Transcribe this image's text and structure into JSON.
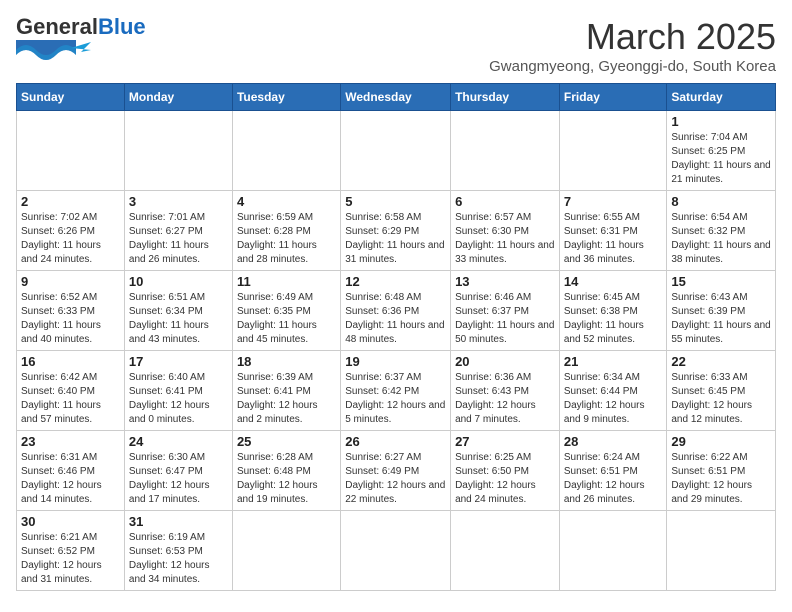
{
  "header": {
    "logo_general": "General",
    "logo_blue": "Blue",
    "month_title": "March 2025",
    "location": "Gwangmyeong, Gyeonggi-do, South Korea"
  },
  "weekdays": [
    "Sunday",
    "Monday",
    "Tuesday",
    "Wednesday",
    "Thursday",
    "Friday",
    "Saturday"
  ],
  "weeks": [
    [
      {
        "day": "",
        "info": ""
      },
      {
        "day": "",
        "info": ""
      },
      {
        "day": "",
        "info": ""
      },
      {
        "day": "",
        "info": ""
      },
      {
        "day": "",
        "info": ""
      },
      {
        "day": "",
        "info": ""
      },
      {
        "day": "1",
        "info": "Sunrise: 7:04 AM\nSunset: 6:25 PM\nDaylight: 11 hours and 21 minutes."
      }
    ],
    [
      {
        "day": "2",
        "info": "Sunrise: 7:02 AM\nSunset: 6:26 PM\nDaylight: 11 hours and 24 minutes."
      },
      {
        "day": "3",
        "info": "Sunrise: 7:01 AM\nSunset: 6:27 PM\nDaylight: 11 hours and 26 minutes."
      },
      {
        "day": "4",
        "info": "Sunrise: 6:59 AM\nSunset: 6:28 PM\nDaylight: 11 hours and 28 minutes."
      },
      {
        "day": "5",
        "info": "Sunrise: 6:58 AM\nSunset: 6:29 PM\nDaylight: 11 hours and 31 minutes."
      },
      {
        "day": "6",
        "info": "Sunrise: 6:57 AM\nSunset: 6:30 PM\nDaylight: 11 hours and 33 minutes."
      },
      {
        "day": "7",
        "info": "Sunrise: 6:55 AM\nSunset: 6:31 PM\nDaylight: 11 hours and 36 minutes."
      },
      {
        "day": "8",
        "info": "Sunrise: 6:54 AM\nSunset: 6:32 PM\nDaylight: 11 hours and 38 minutes."
      }
    ],
    [
      {
        "day": "9",
        "info": "Sunrise: 6:52 AM\nSunset: 6:33 PM\nDaylight: 11 hours and 40 minutes."
      },
      {
        "day": "10",
        "info": "Sunrise: 6:51 AM\nSunset: 6:34 PM\nDaylight: 11 hours and 43 minutes."
      },
      {
        "day": "11",
        "info": "Sunrise: 6:49 AM\nSunset: 6:35 PM\nDaylight: 11 hours and 45 minutes."
      },
      {
        "day": "12",
        "info": "Sunrise: 6:48 AM\nSunset: 6:36 PM\nDaylight: 11 hours and 48 minutes."
      },
      {
        "day": "13",
        "info": "Sunrise: 6:46 AM\nSunset: 6:37 PM\nDaylight: 11 hours and 50 minutes."
      },
      {
        "day": "14",
        "info": "Sunrise: 6:45 AM\nSunset: 6:38 PM\nDaylight: 11 hours and 52 minutes."
      },
      {
        "day": "15",
        "info": "Sunrise: 6:43 AM\nSunset: 6:39 PM\nDaylight: 11 hours and 55 minutes."
      }
    ],
    [
      {
        "day": "16",
        "info": "Sunrise: 6:42 AM\nSunset: 6:40 PM\nDaylight: 11 hours and 57 minutes."
      },
      {
        "day": "17",
        "info": "Sunrise: 6:40 AM\nSunset: 6:41 PM\nDaylight: 12 hours and 0 minutes."
      },
      {
        "day": "18",
        "info": "Sunrise: 6:39 AM\nSunset: 6:41 PM\nDaylight: 12 hours and 2 minutes."
      },
      {
        "day": "19",
        "info": "Sunrise: 6:37 AM\nSunset: 6:42 PM\nDaylight: 12 hours and 5 minutes."
      },
      {
        "day": "20",
        "info": "Sunrise: 6:36 AM\nSunset: 6:43 PM\nDaylight: 12 hours and 7 minutes."
      },
      {
        "day": "21",
        "info": "Sunrise: 6:34 AM\nSunset: 6:44 PM\nDaylight: 12 hours and 9 minutes."
      },
      {
        "day": "22",
        "info": "Sunrise: 6:33 AM\nSunset: 6:45 PM\nDaylight: 12 hours and 12 minutes."
      }
    ],
    [
      {
        "day": "23",
        "info": "Sunrise: 6:31 AM\nSunset: 6:46 PM\nDaylight: 12 hours and 14 minutes."
      },
      {
        "day": "24",
        "info": "Sunrise: 6:30 AM\nSunset: 6:47 PM\nDaylight: 12 hours and 17 minutes."
      },
      {
        "day": "25",
        "info": "Sunrise: 6:28 AM\nSunset: 6:48 PM\nDaylight: 12 hours and 19 minutes."
      },
      {
        "day": "26",
        "info": "Sunrise: 6:27 AM\nSunset: 6:49 PM\nDaylight: 12 hours and 22 minutes."
      },
      {
        "day": "27",
        "info": "Sunrise: 6:25 AM\nSunset: 6:50 PM\nDaylight: 12 hours and 24 minutes."
      },
      {
        "day": "28",
        "info": "Sunrise: 6:24 AM\nSunset: 6:51 PM\nDaylight: 12 hours and 26 minutes."
      },
      {
        "day": "29",
        "info": "Sunrise: 6:22 AM\nSunset: 6:51 PM\nDaylight: 12 hours and 29 minutes."
      }
    ],
    [
      {
        "day": "30",
        "info": "Sunrise: 6:21 AM\nSunset: 6:52 PM\nDaylight: 12 hours and 31 minutes."
      },
      {
        "day": "31",
        "info": "Sunrise: 6:19 AM\nSunset: 6:53 PM\nDaylight: 12 hours and 34 minutes."
      },
      {
        "day": "",
        "info": ""
      },
      {
        "day": "",
        "info": ""
      },
      {
        "day": "",
        "info": ""
      },
      {
        "day": "",
        "info": ""
      },
      {
        "day": "",
        "info": ""
      }
    ]
  ]
}
